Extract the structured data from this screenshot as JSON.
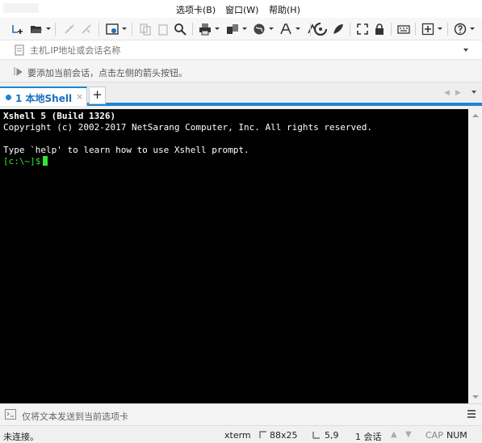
{
  "menu": {
    "items": [
      "选项卡(B)",
      "窗口(W)",
      "帮助(H)"
    ]
  },
  "toolbar": {
    "icons": [
      "new-session-icon",
      "open-folder-icon",
      "connect-icon",
      "disconnect-icon",
      "properties-icon",
      "copy-icon",
      "paste-icon",
      "find-icon",
      "print-icon",
      "transfer-icon",
      "globe-icon",
      "font-icon",
      "encoding-icon",
      "xftp-icon",
      "xagent-icon",
      "fullscreen-icon",
      "lock-icon",
      "keyboard-icon",
      "add-icon",
      "help-icon"
    ]
  },
  "address": {
    "placeholder": "主机,IP地址或会话名称"
  },
  "hint": {
    "text": "要添加当前会话，点击左侧的箭头按钮。"
  },
  "tabs": [
    {
      "label": "1 本地Shell",
      "active": true,
      "close": "×"
    }
  ],
  "tab_add": "+",
  "terminal": {
    "title": "Xshell 5 (Build 1326)",
    "copyright": "Copyright (c) 2002-2017 NetSarang Computer, Inc. All rights reserved.",
    "help": "Type `help' to learn how to use Xshell prompt.",
    "prompt": "[c:\\~]$",
    "bg_color": "#000000",
    "prompt_color": "#36e236"
  },
  "sendbar": {
    "text": "仅将文本发送到当前选项卡"
  },
  "status": {
    "connection": "未连接。",
    "term_type": "xterm",
    "size": "88x25",
    "position": "5,9",
    "sessions": "1 会话",
    "caps": "CAP",
    "num": "NUM"
  },
  "accent_color": "#1a86d4"
}
